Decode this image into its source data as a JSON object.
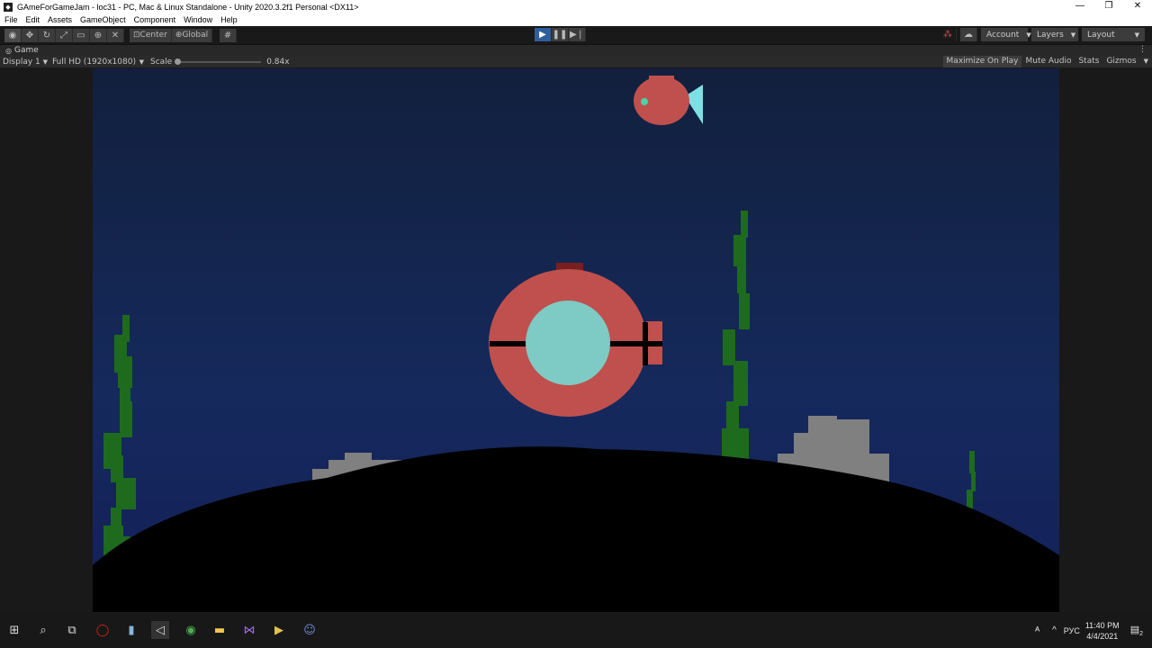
{
  "window": {
    "title": "GAmeForGameJam - loc31 - PC, Mac & Linux Standalone - Unity 2020.3.2f1 Personal <DX11>",
    "controls": [
      "—",
      "❐",
      "✕"
    ]
  },
  "menu": [
    "File",
    "Edit",
    "Assets",
    "GameObject",
    "Component",
    "Window",
    "Help"
  ],
  "toolbar": {
    "pivot_label": "Center",
    "space_label": "Global",
    "account_label": "Account",
    "layers_label": "Layers",
    "layout_label": "Layout"
  },
  "game_tab": {
    "label": "Game",
    "display": "Display 1",
    "resolution": "Full HD (1920x1080)",
    "scale_label": "Scale",
    "scale_value": "0.84x",
    "maximize": "Maximize On Play",
    "mute": "Mute Audio",
    "stats": "Stats",
    "gizmos": "Gizmos"
  },
  "taskbar": {
    "language": "РУС",
    "time": "11:40 PM",
    "date": "4/4/2021",
    "notifications": "2"
  },
  "colors": {
    "play_active": "#2e5f9c",
    "sub_body": "#c0504d",
    "porthole": "#7ecac4",
    "fish_fin": "#7ee0e4",
    "seaweed": "#1e6b1e",
    "rock": "#808080"
  }
}
